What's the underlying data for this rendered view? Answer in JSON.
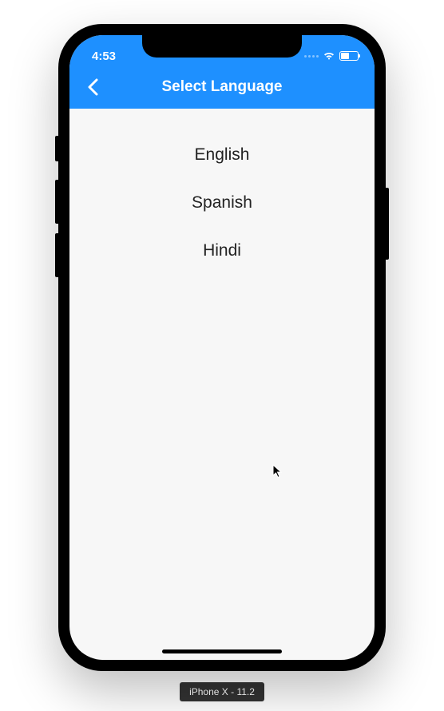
{
  "status_bar": {
    "time": "4:53"
  },
  "nav": {
    "title": "Select Language"
  },
  "languages": {
    "items": [
      {
        "label": "English"
      },
      {
        "label": "Spanish"
      },
      {
        "label": "Hindi"
      }
    ]
  },
  "device": {
    "label": "iPhone X - 11.2"
  }
}
